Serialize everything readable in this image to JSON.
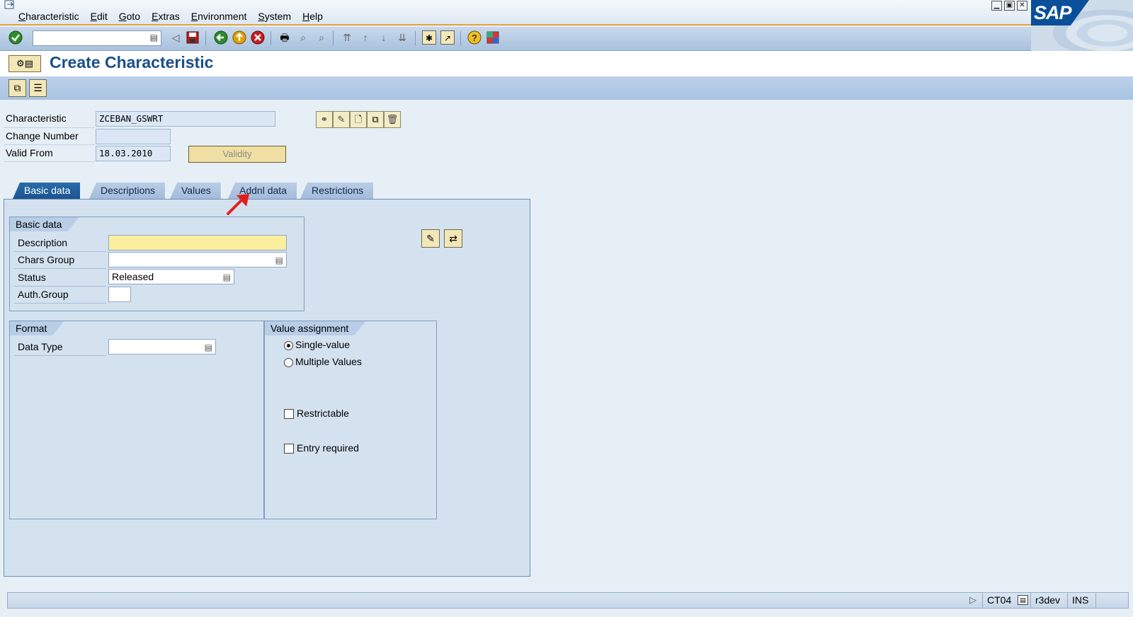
{
  "menubar": {
    "items": [
      "Characteristic",
      "Edit",
      "Goto",
      "Extras",
      "Environment",
      "System",
      "Help"
    ]
  },
  "window_controls": [
    "▁",
    "▣",
    "✕"
  ],
  "logo_text": "SAP",
  "toolbar": {
    "command_field_value": ""
  },
  "title": "Create Characteristic",
  "header": {
    "characteristic_label": "Characteristic",
    "characteristic_value": "ZCEBAN_GSWRT",
    "change_number_label": "Change Number",
    "change_number_value": "",
    "valid_from_label": "Valid From",
    "valid_from_value": "18.03.2010",
    "validity_button": "Validity"
  },
  "tabs": [
    {
      "label": "Basic data",
      "active": true
    },
    {
      "label": "Descriptions",
      "active": false
    },
    {
      "label": "Values",
      "active": false
    },
    {
      "label": "Addnl data",
      "active": false
    },
    {
      "label": "Restrictions",
      "active": false
    }
  ],
  "basic_data": {
    "group_title": "Basic data",
    "description_label": "Description",
    "description_value": "",
    "chars_group_label": "Chars Group",
    "chars_group_value": "",
    "status_label": "Status",
    "status_value": "Released",
    "auth_group_label": "Auth.Group",
    "auth_group_value": ""
  },
  "format": {
    "group_title": "Format",
    "data_type_label": "Data Type",
    "data_type_value": ""
  },
  "value_assignment": {
    "group_title": "Value assignment",
    "single_value_label": "Single-value",
    "single_value_selected": true,
    "multiple_values_label": "Multiple Values",
    "multiple_values_selected": false,
    "restrictable_label": "Restrictable",
    "restrictable_checked": false,
    "entry_required_label": "Entry required",
    "entry_required_checked": false
  },
  "statusbar": {
    "transaction": "CT04",
    "system": "r3dev",
    "mode": "INS"
  },
  "colors": {
    "title": "#1a4f8a",
    "active_tab": "#1b5590",
    "required_field": "#fbef9e",
    "menu_accent": "#e8a23a",
    "annotation_arrow": "#e0201e"
  }
}
